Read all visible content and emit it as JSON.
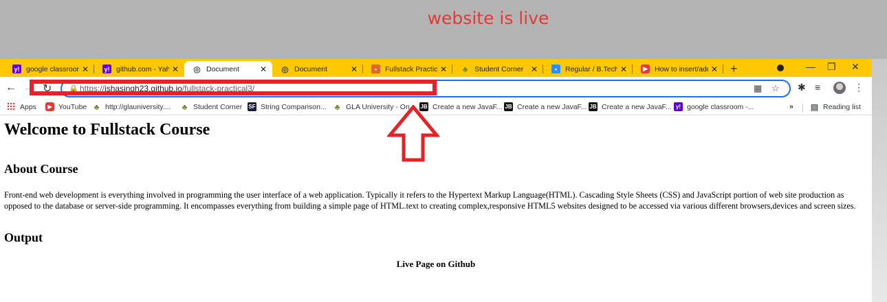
{
  "annotation": {
    "text": "website is live",
    "color": "#e53935"
  },
  "tabs": [
    {
      "title": "google classroom",
      "favicon": "yahoo-icon",
      "active": false
    },
    {
      "title": "github.com - Yaho",
      "favicon": "yahoo-icon",
      "active": false
    },
    {
      "title": "Document",
      "favicon": "globe-icon",
      "active": true
    },
    {
      "title": "Document",
      "favicon": "globe-icon",
      "active": false
    },
    {
      "title": "Fullstack Practical",
      "favicon": "classroom-icon",
      "active": false
    },
    {
      "title": "Student Corner",
      "favicon": "frog-icon",
      "active": false
    },
    {
      "title": "Regular / B.Tech.",
      "favicon": "meet-icon",
      "active": false
    },
    {
      "title": "How to insert/add",
      "favicon": "youtube-icon",
      "active": false
    }
  ],
  "address_bar": {
    "scheme": "https://",
    "host": "ishasingh23.github.io",
    "path": "/fullstack-practical3/"
  },
  "bookmarks": [
    {
      "label": "Apps",
      "icon": "apps-grid-icon"
    },
    {
      "label": "YouTube",
      "icon": "youtube-icon"
    },
    {
      "label": "http://glauniversity....",
      "icon": "frog-icon"
    },
    {
      "label": "Student Corner",
      "icon": "frog-icon"
    },
    {
      "label": "String Comparison...",
      "icon": "sf-icon"
    },
    {
      "label": "GLA University - On",
      "icon": "frog-icon"
    },
    {
      "label": "Create a new JavaF...",
      "icon": "jb-icon"
    },
    {
      "label": "Create a new JavaF...",
      "icon": "jb-icon"
    },
    {
      "label": "Create a new JavaF...",
      "icon": "jb-icon"
    },
    {
      "label": "google classroom -...",
      "icon": "yahoo-icon"
    }
  ],
  "bookmarks_overflow": "»",
  "reading_list": "Reading list",
  "page": {
    "heading": "Welcome to Fullstack Course",
    "about_heading": "About Course",
    "about_text": "Front-end web development is everything involved in programming the user interface of a web application. Typically it refers to the Hypertext Markup Language(HTML). Cascading Style Sheets (CSS) and JavaScript portion of web site production as opposed to the database or server-side programming. It encompasses everything from building a simple page of HTML.text to creating complex,responsive HTML5 websites designed to be accessed via various different browsers,devices and screen sizes.",
    "output_heading": "Output",
    "live_text": "Live Page on Github"
  },
  "colors": {
    "tabstrip": "#ffc800",
    "highlight": "#e52226",
    "omnibox_border": "#1a73e8"
  }
}
